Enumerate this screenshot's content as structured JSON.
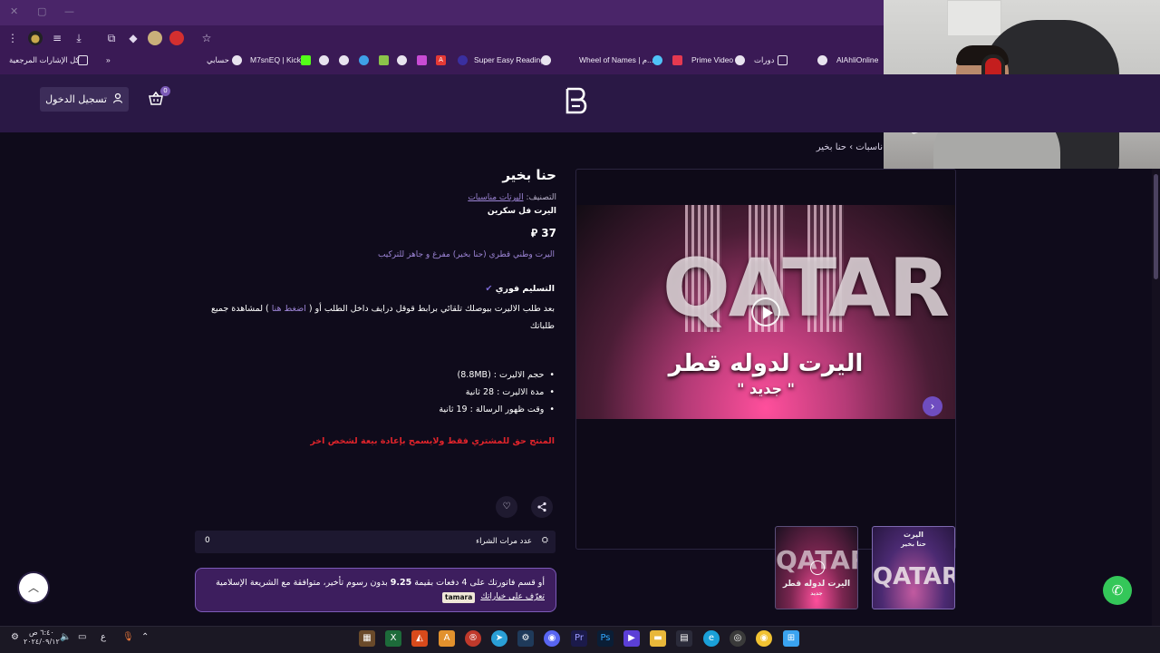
{
  "browser": {
    "bookmarks": [
      {
        "label": "كل الإشارات المرجعية"
      },
      {
        "label": "حسابي"
      },
      {
        "label": "M7snEQ | Kick"
      },
      {
        "label": "Super Easy Reading"
      },
      {
        "label": "Wheel of Names | م..."
      },
      {
        "label": "Prime Video"
      },
      {
        "label": "دورات"
      },
      {
        "label": "AlAhliOnline"
      }
    ]
  },
  "header": {
    "login_label": "تسجيل الدخول",
    "cart_count": "0"
  },
  "breadcrumb": {
    "text": "ناسبات  ›  حنا بخير"
  },
  "product": {
    "title": "حنا بخير",
    "category_label": "التصنيف:",
    "category_value": "اليرتات مناسبات",
    "type": "اليرت فل سكرين",
    "price": "37 ⃁",
    "description": "اليرت وطني قطري (حنا بخير) مفرغ و جاهز للتركيب",
    "delivery_heading": "التسليم فوري",
    "delivery_text_1": "بعد طلب الاليرت بيوصلك تلقائي برابط قوقل درايف داخل الطلب أو ( ",
    "delivery_link": "اضغط هنا",
    "delivery_text_2": " ) لمشاهدة جميع طلباتك",
    "specs": [
      "حجم الاليرت : (8.8MB)",
      "مدة الاليرت : 28 ثانية",
      "وقت ظهور الرسالة : 19 ثانية"
    ],
    "warning": "المنتج حق للمشتري فقط ولايسمح بإعادة بيعة لشخص اخر"
  },
  "video": {
    "big_text": "QATAR",
    "title": "اليرت لدوله قطر",
    "subtitle": "\" جديد \""
  },
  "thumbs": {
    "left_title": "اليرت لدوله قطر",
    "left_sub": "جديد",
    "right_top": "اليرت",
    "right_sub": "حنا بخير",
    "right_big": "QATAR"
  },
  "purchases": {
    "label": "عدد مرات الشراء",
    "count": "0"
  },
  "tamara": {
    "line1_a": "أو قسم فاتورتك على 4 دفعات بقيمة ",
    "line1_amount": "9.25",
    "line1_b": " بدون رسوم تأخير، متوافقة مع الشريعة الإسلامية",
    "line2": "تعرّف على خياراتك",
    "badge": "tamara"
  },
  "taskbar": {
    "clock_time": "٦:٤٠ ص",
    "clock_date": "٢٠٢٤/٠٩/١٢",
    "lang": "ع"
  },
  "icons": {
    "whatsapp_color": "#34c759",
    "accent": "#7c5bb8"
  }
}
